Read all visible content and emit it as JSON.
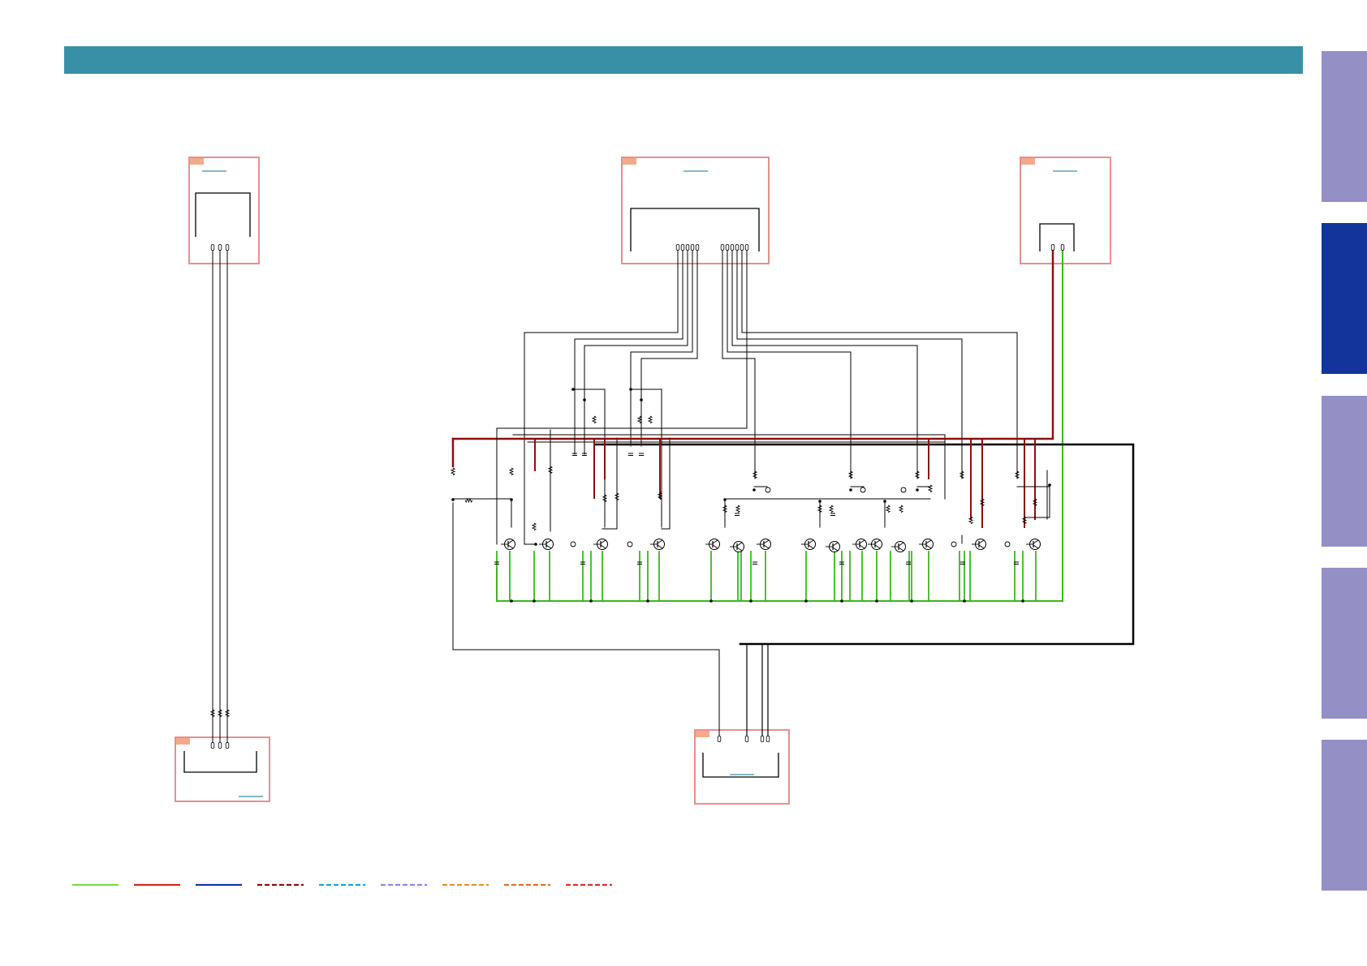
{
  "side_tabs": [
    {
      "label": "",
      "active": false
    },
    {
      "label": "",
      "active": true
    },
    {
      "label": "",
      "active": false
    },
    {
      "label": "",
      "active": false
    },
    {
      "label": "",
      "active": false
    }
  ],
  "colors": {
    "header": "#3890a7",
    "tab": "#9490c6",
    "tab_active": "#13349a",
    "board_outline": "#e88f8f",
    "board_tag": "#f4aa8a",
    "ground_trace": "#3ab81c",
    "power_trace": "#8b1010",
    "signal_trace": "#000000"
  },
  "legend": [
    {
      "color": "#7bd94a",
      "style": "solid"
    },
    {
      "color": "#d22b1c",
      "style": "solid"
    },
    {
      "color": "#1437a8",
      "style": "solid"
    },
    {
      "color": "#8b1010",
      "style": "dashed"
    },
    {
      "color": "#1ba3d8",
      "style": "dashed"
    },
    {
      "color": "#8c87e6",
      "style": "dashed"
    },
    {
      "color": "#e0952a",
      "style": "dashed"
    },
    {
      "color": "#e0702a",
      "style": "dashed"
    },
    {
      "color": "#d93030",
      "style": "dashed"
    }
  ],
  "boards": [
    {
      "id": "board-top-left"
    },
    {
      "id": "board-top-center"
    },
    {
      "id": "board-top-right"
    },
    {
      "id": "board-bottom-left"
    },
    {
      "id": "board-bottom-center"
    }
  ]
}
